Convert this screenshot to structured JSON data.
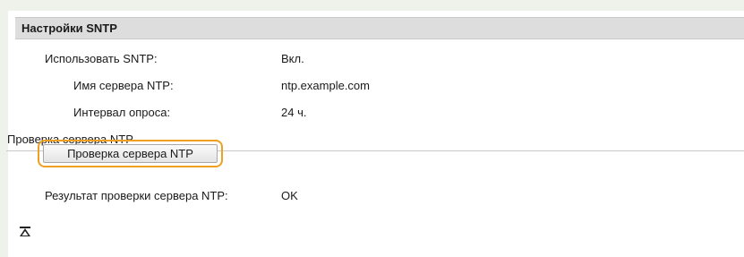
{
  "section": {
    "title": "Настройки SNTP"
  },
  "rows": [
    {
      "label": "Использовать SNTP:",
      "value": "Вкл."
    },
    {
      "label": "Имя сервера NTP:",
      "value": "ntp.example.com"
    },
    {
      "label": "Интервал опроса:",
      "value": "24 ч."
    }
  ],
  "check": {
    "subheader": "Проверка сервера NTP",
    "button_label": "Проверка сервера NTP",
    "result_label": "Результат проверки сервера NTP:",
    "result_value": "OK"
  },
  "icons": {
    "top": "back-to-top-icon"
  },
  "colors": {
    "page_bg": "#eef2ea",
    "header_bg": "#dddddd",
    "focus_ring": "#f0a020"
  }
}
